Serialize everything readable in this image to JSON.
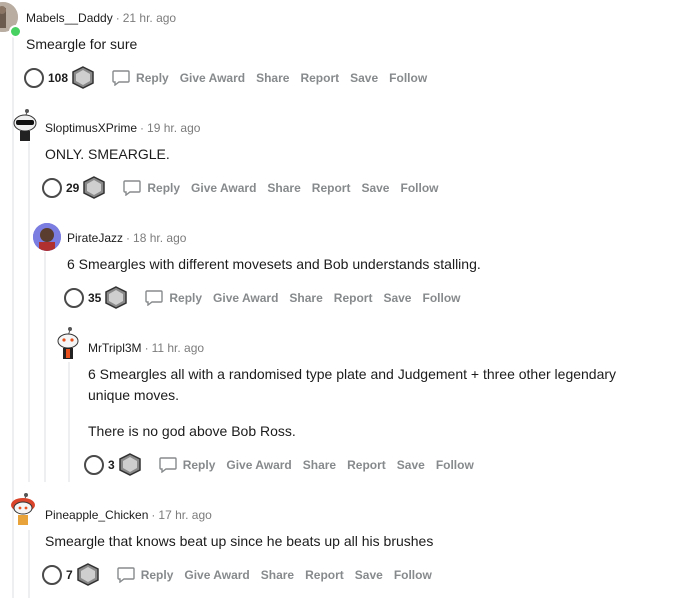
{
  "comments": [
    {
      "username": "Mabels__Daddy",
      "time": "21 hr. ago",
      "body": [
        "Smeargle for sure"
      ],
      "votes": "108",
      "avatar_icon": "mabels-avatar-icon"
    },
    {
      "username": "SloptimusXPrime",
      "time": "19 hr. ago",
      "body": [
        "ONLY. SMEARGLE."
      ],
      "votes": "29",
      "avatar_icon": "snoo-sunglasses-avatar-icon"
    },
    {
      "username": "PirateJazz",
      "time": "18 hr. ago",
      "body": [
        "6 Smeargles with different movesets and Bob understands stalling."
      ],
      "votes": "35",
      "avatar_icon": "piratejazz-avatar-icon"
    },
    {
      "username": "MrTripl3M",
      "time": "11 hr. ago",
      "body": [
        "6 Smeargles all with a randomised type plate and Judgement + three other legendary",
        "unique moves.",
        "There is no god above Bob Ross."
      ],
      "votes": "3",
      "avatar_icon": "snoo-avatar-icon"
    },
    {
      "username": "Pineapple_Chicken",
      "time": "17 hr. ago",
      "body": [
        "Smeargle that knows beat up since he beats up all his brushes"
      ],
      "votes": "7",
      "avatar_icon": "snoo-red-hair-avatar-icon"
    }
  ],
  "actions": {
    "reply": "Reply",
    "give_award": "Give Award",
    "share": "Share",
    "report": "Report",
    "save": "Save",
    "follow": "Follow"
  },
  "colors": {
    "online": "#46d160",
    "meta": "#7c7c7c",
    "action": "#878a8c",
    "thread_line": "#edeff1"
  }
}
